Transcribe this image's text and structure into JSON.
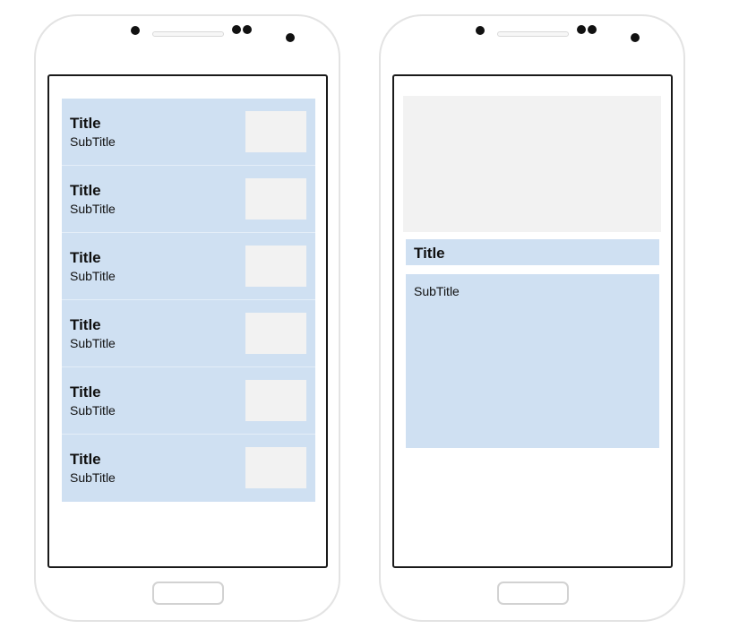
{
  "colors": {
    "phone_outline": "#e3e3e3",
    "screen_border": "#1a1a1a",
    "item_background": "#cfe0f2",
    "placeholder": "#f2f2f2"
  },
  "list_screen": {
    "items": [
      {
        "title": "Title",
        "subtitle": "SubTitle"
      },
      {
        "title": "Title",
        "subtitle": "SubTitle"
      },
      {
        "title": "Title",
        "subtitle": "SubTitle"
      },
      {
        "title": "Title",
        "subtitle": "SubTitle"
      },
      {
        "title": "Title",
        "subtitle": "SubTitle"
      },
      {
        "title": "Title",
        "subtitle": "SubTitle"
      }
    ]
  },
  "detail_screen": {
    "title": "Title",
    "subtitle": "SubTitle"
  }
}
